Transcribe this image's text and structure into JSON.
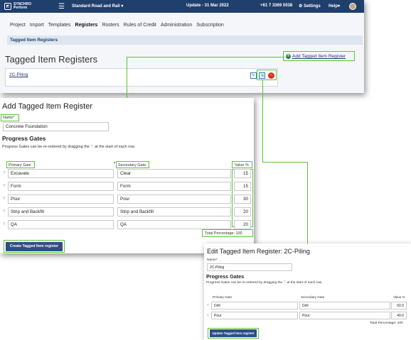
{
  "topbar": {
    "brand_line1": "SYNCHRO",
    "brand_line2": "Perform",
    "project": "Standard Road and Rail",
    "update": "Update - 31 Mar 2022",
    "phone": "+61 7 3369 0038",
    "settings": "Settings",
    "help": "Help"
  },
  "nav": {
    "items": [
      "Project",
      "Import",
      "Templates",
      "Registers",
      "Rosters",
      "Rules of Credit",
      "Administration",
      "Subscription"
    ],
    "active": "Registers"
  },
  "breadcrumb": "Tagged Item Registers",
  "page_title": "Tagged Item Registers",
  "add_link": "Add Tagged Item Register",
  "registers": [
    {
      "name": "2C-Piling"
    }
  ],
  "add_form": {
    "title": "Add Tagged Item Register",
    "name_label": "Name*",
    "name_value": "Concrete Foundation",
    "section": "Progress Gates",
    "note": "Progress Gates can be re-ordered by dragging the",
    "note_end": "at the start of each row.",
    "col_primary": "Primary Gate",
    "col_secondary": "Secondary Gate",
    "col_value": "Value %",
    "rows": [
      {
        "primary": "Excavate",
        "secondary": "Clear",
        "value": "15"
      },
      {
        "primary": "Form",
        "secondary": "Form",
        "value": "15"
      },
      {
        "primary": "Pour",
        "secondary": "Pour",
        "value": "30"
      },
      {
        "primary": "Strip and Backfill",
        "secondary": "Strip and Backfill",
        "value": "20"
      },
      {
        "primary": "QA",
        "secondary": "QA",
        "value": "20"
      }
    ],
    "total": "Total Percentage: 100",
    "button": "Create Tagged Item register"
  },
  "edit_form": {
    "title": "Edit Tagged Item Register: 2C-Piling",
    "name_label": "Name*",
    "name_value": "2C-Piling",
    "section": "Progress Gates",
    "note": "Progress Gates can be re-ordered by dragging the",
    "note_end": "at the start of each row.",
    "col_primary": "Primary Gate",
    "col_secondary": "Secondary Gate",
    "col_value": "Value %",
    "rows": [
      {
        "primary": "Drill",
        "secondary": "Drill",
        "value": "60.0"
      },
      {
        "primary": "Pour",
        "secondary": "Pour",
        "value": "40.0"
      }
    ],
    "total": "Total Percentage: 100",
    "button": "Update Tagged item register"
  },
  "colors": {
    "navy": "#1f3f6d",
    "highlight": "#5fc33a",
    "button": "#2d4f83",
    "delete": "#d9341c"
  }
}
